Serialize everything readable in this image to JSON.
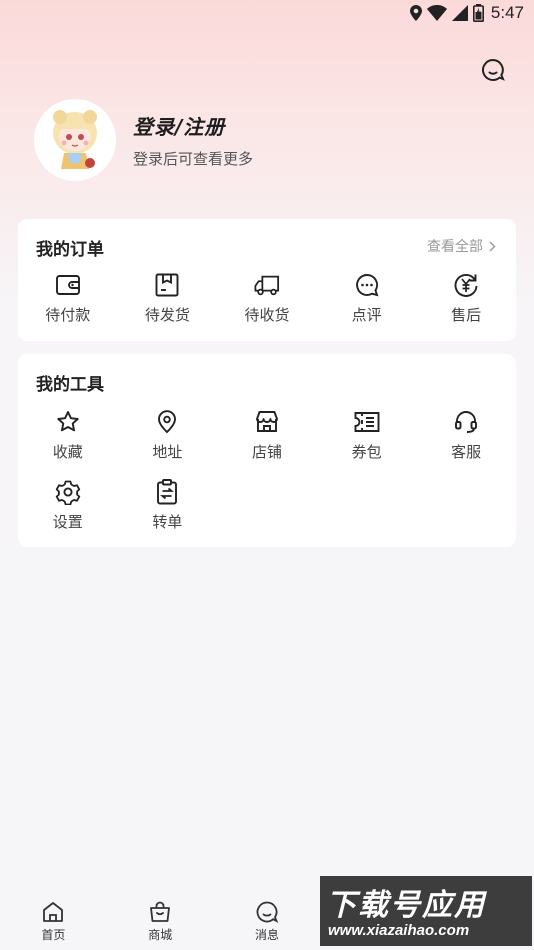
{
  "status_bar": {
    "time": "5:47"
  },
  "profile": {
    "title": "登录/注册",
    "subtitle": "登录后可查看更多"
  },
  "orders": {
    "title": "我的订单",
    "view_all": "查看全部",
    "items": [
      {
        "label": "待付款",
        "icon": "wallet-icon"
      },
      {
        "label": "待发货",
        "icon": "package-icon"
      },
      {
        "label": "待收货",
        "icon": "truck-icon"
      },
      {
        "label": "点评",
        "icon": "comment-icon"
      },
      {
        "label": "售后",
        "icon": "yen-refund-icon"
      }
    ]
  },
  "tools": {
    "title": "我的工具",
    "items": [
      {
        "label": "收藏",
        "icon": "star-icon"
      },
      {
        "label": "地址",
        "icon": "location-icon"
      },
      {
        "label": "店铺",
        "icon": "store-icon"
      },
      {
        "label": "券包",
        "icon": "coupon-icon"
      },
      {
        "label": "客服",
        "icon": "headset-icon"
      },
      {
        "label": "设置",
        "icon": "gear-icon"
      },
      {
        "label": "转单",
        "icon": "transfer-icon"
      }
    ]
  },
  "tabbar": {
    "items": [
      {
        "label": "首页",
        "icon": "home-icon"
      },
      {
        "label": "商城",
        "icon": "bag-icon"
      },
      {
        "label": "消息",
        "icon": "message-icon"
      },
      {
        "label": "",
        "icon": "tab-4-icon"
      },
      {
        "label": "",
        "icon": "tab-5-icon"
      }
    ]
  },
  "watermark": {
    "logo": "下载号应用",
    "url": "www.xiazaihao.com"
  },
  "colors": {
    "accent": "#f2b8c0",
    "text": "#222222",
    "muted": "#999999"
  }
}
